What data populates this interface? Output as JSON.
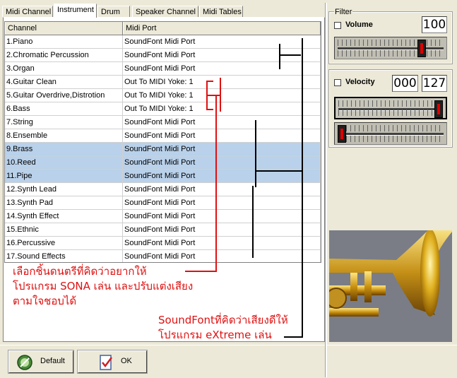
{
  "tabs": [
    "Midi Channel",
    "Instrument",
    "Drum",
    "Speaker Channel",
    "Midi Tables"
  ],
  "active_tab": "Instrument",
  "table": {
    "headers": [
      "Channel",
      "Midi Port"
    ],
    "rows": [
      {
        "channel": "1.Piano",
        "port": "SoundFont Midi Port",
        "selected": false
      },
      {
        "channel": "2.Chromatic Percussion",
        "port": "SoundFont Midi Port",
        "selected": false
      },
      {
        "channel": "3.Organ",
        "port": "SoundFont Midi Port",
        "selected": false
      },
      {
        "channel": "4.Guitar Clean",
        "port": "Out To MIDI Yoke:  1",
        "selected": false
      },
      {
        "channel": "5.Guitar Overdrive,Distrotion",
        "port": "Out To MIDI Yoke:  1",
        "selected": false
      },
      {
        "channel": "6.Bass",
        "port": "Out To MIDI Yoke:  1",
        "selected": false
      },
      {
        "channel": "7.String",
        "port": "SoundFont Midi Port",
        "selected": false
      },
      {
        "channel": "8.Ensemble",
        "port": "SoundFont Midi Port",
        "selected": false
      },
      {
        "channel": "9.Brass",
        "port": "SoundFont Midi Port",
        "selected": true
      },
      {
        "channel": "10.Reed",
        "port": "SoundFont Midi Port",
        "selected": true
      },
      {
        "channel": "11.Pipe",
        "port": "SoundFont Midi Port",
        "selected": true
      },
      {
        "channel": "12.Synth Lead",
        "port": "SoundFont Midi Port",
        "selected": false
      },
      {
        "channel": "13.Synth Pad",
        "port": "SoundFont Midi Port",
        "selected": false
      },
      {
        "channel": "14.Synth Effect",
        "port": "SoundFont Midi Port",
        "selected": false
      },
      {
        "channel": "15.Ethnic",
        "port": "SoundFont Midi Port",
        "selected": false
      },
      {
        "channel": "16.Percussive",
        "port": "SoundFont Midi Port",
        "selected": false
      },
      {
        "channel": "17.Sound Effects",
        "port": "SoundFont Midi Port",
        "selected": false
      }
    ]
  },
  "filter": {
    "title": "Filter",
    "volume_label": "Volume",
    "volume_value": "100",
    "volume_checked": false,
    "volume_slider_fraction": 0.82
  },
  "velocity": {
    "label": "Velocity",
    "min_value": "000",
    "max_value": "127",
    "checked": false,
    "max_slider_fraction": 1.0,
    "min_slider_fraction": 0.0
  },
  "buttons": {
    "default_label": "Default",
    "ok_label": "OK"
  },
  "annotations": {
    "red_line1": "เลือกชิ้นดนตรีที่คิดว่าอยากให้",
    "red_line2": "โปรแกรม SONA เล่น และปรับแต่งเสียง",
    "red_line3": "ตามใจชอบได้",
    "black_line1": "SoundFontที่คิดว่าเสียงดีให้",
    "black_line2": "โปรแกรม eXtreme เล่น"
  },
  "colors": {
    "selection": "#B9D1EA",
    "annotation_red": "#E01010",
    "slider_thumb_accent": "#E00000"
  }
}
